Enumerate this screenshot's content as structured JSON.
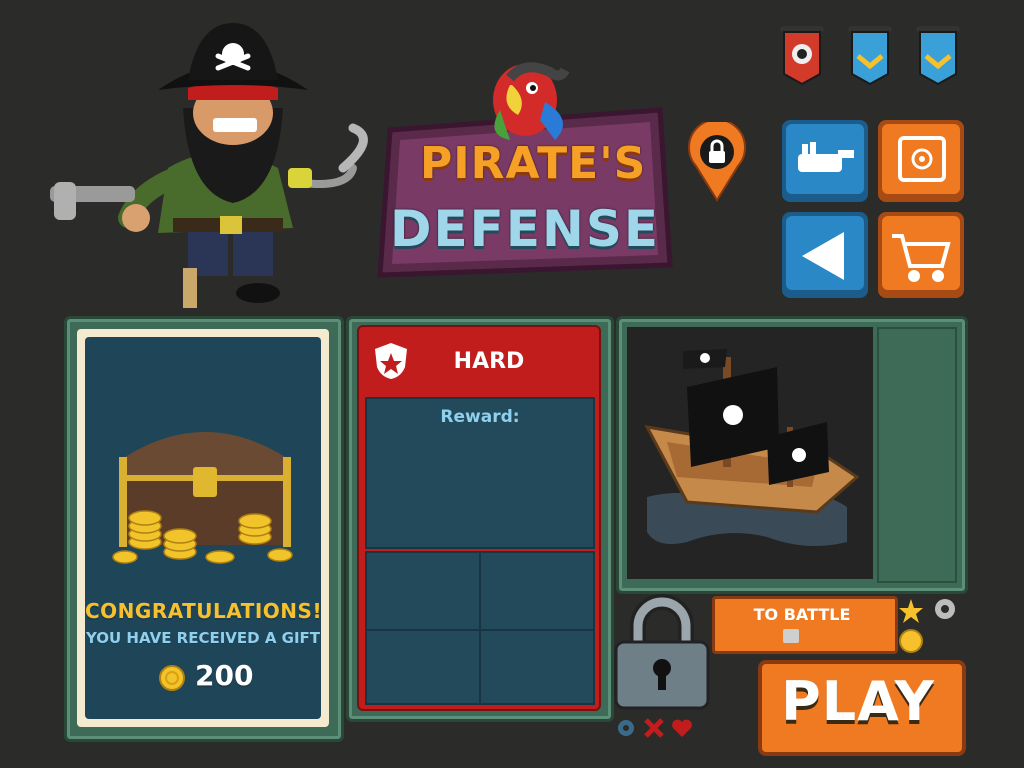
{
  "logo": {
    "line1": "PIRATE'S",
    "line2": "DEFENSE"
  },
  "top_banners": [
    {
      "icon": "skull-gear-banner-icon",
      "color": "#d23a2a"
    },
    {
      "icon": "chevron-banner-icon",
      "color": "#3aa0d8"
    },
    {
      "icon": "chevron-banner-icon",
      "color": "#3aa0d8"
    }
  ],
  "menu_buttons": [
    {
      "icon": "guitar-hand-icon",
      "color": "#2a88c6"
    },
    {
      "icon": "safe-icon",
      "color": "#f07a22"
    },
    {
      "icon": "back-arrow-icon",
      "color": "#2a88c6"
    },
    {
      "icon": "shopping-cart-icon",
      "color": "#f07a22"
    }
  ],
  "gift_card": {
    "title": "CONGRATULATIONS!",
    "subtitle": "YOU HAVE RECEIVED A GIFT",
    "amount": "200"
  },
  "difficulty": {
    "label": "HARD",
    "reward_label": "Reward:"
  },
  "battle": {
    "label": "TO BATTLE"
  },
  "play": {
    "label": "PLAY"
  },
  "colors": {
    "gold": "#f6c12c",
    "orange": "#f07a22",
    "blue": "#2a88c6",
    "red": "#c11d1d",
    "panel": "#3e6a58"
  }
}
